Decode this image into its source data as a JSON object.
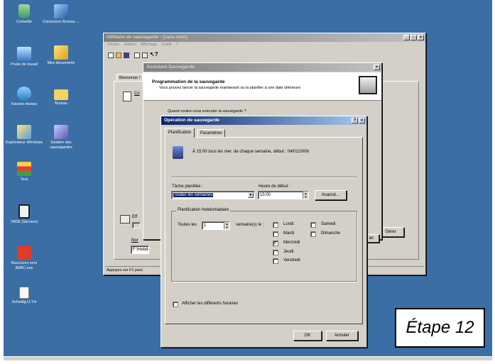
{
  "desktop": {
    "icons": [
      {
        "label": "Corbeille",
        "icon": "recycle-bin-icon"
      },
      {
        "label": "Connexion Bureau ...",
        "icon": "remote-desktop-icon"
      },
      {
        "label": "Poste de travail",
        "icon": "my-computer-icon"
      },
      {
        "label": "Mes documents",
        "icon": "my-documents-icon"
      },
      {
        "label": "Favoris réseau",
        "icon": "network-places-icon"
      },
      {
        "label": "Bureau",
        "icon": "folder-icon"
      },
      {
        "label": "Explorateur Windows",
        "icon": "explorer-icon"
      },
      {
        "label": "Gestion des sauvegardes",
        "icon": "backup-management-icon"
      },
      {
        "label": "Tara",
        "icon": "application-icon"
      },
      {
        "label": "TADE (Serveur)",
        "icon": "server-app-icon"
      },
      {
        "label": "Raccourci vers BdBC.exe",
        "icon": "shortcut-icon"
      },
      {
        "label": "Schedlg.U.Txt",
        "icon": "text-file-icon"
      }
    ]
  },
  "backup_utility": {
    "title": "Utilitaire de sauvegarde - [sans nom]",
    "menu": [
      "Fichier",
      "Édition",
      "Affichage",
      "Outils",
      "?"
    ],
    "tab_welcome": "Bienvenue !",
    "left_label_1": "Co",
    "left_label_2": "Eff",
    "field_label": "Nor",
    "field_value": "F:\\Hebdo",
    "gerer_button": "Gérer",
    "status": "Appuyez sur F1 pour"
  },
  "wizard": {
    "title": "Assistant Sauvegarde",
    "heading": "Programmation de la sauvegarde",
    "subheading": "Vous pouvez lancer la sauvegarde maintenant ou la planifier à une date ultérieure.",
    "question": "Quand voulez-vous exécuter la sauvegarde ?",
    "side_button": "ier"
  },
  "operation_dialog": {
    "title": "Opération de sauvegarde",
    "tabs": [
      "Planification",
      "Paramètres"
    ],
    "summary": "À 15:00 tous les mer. de chaque semaine, début : 04/01/2006",
    "task_label": "Tâche planifiée :",
    "task_value": "Toutes les semaines",
    "start_label": "Heure de début :",
    "start_value": "15:00",
    "advanced_button": "Avancé...",
    "weekly_group": "Planification hebdomadaire",
    "every_label": "Toutes les",
    "every_value": "1",
    "weeks_label": "semaine(s) le :",
    "days": [
      {
        "label": "Lundi",
        "checked": false
      },
      {
        "label": "Mardi",
        "checked": false
      },
      {
        "label": "Mercredi",
        "checked": true
      },
      {
        "label": "Jeudi",
        "checked": false
      },
      {
        "label": "Vendredi",
        "checked": false
      },
      {
        "label": "Samedi",
        "checked": false
      },
      {
        "label": "Dimanche",
        "checked": false
      }
    ],
    "show_multiple": "Afficher les différents horaires",
    "ok": "OK",
    "cancel": "Annuler"
  },
  "step_label": "Étape 12",
  "colors": {
    "desktop": "#3a6ea5",
    "title_active": "#0a246a",
    "window": "#d4d0c8"
  }
}
